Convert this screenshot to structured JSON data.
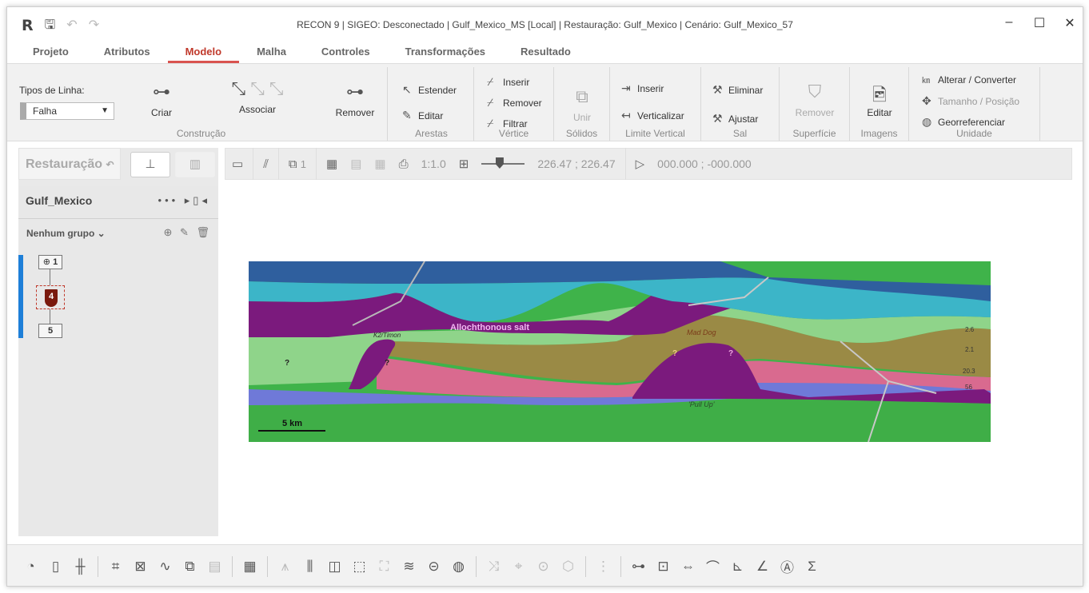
{
  "app": {
    "logo": "R",
    "title": "RECON 9  |  SIGEO: Desconectado  |  Gulf_Mexico_MS [Local]  |  Restauração: Gulf_Mexico  |  Cenário: Gulf_Mexico_57",
    "window_controls": {
      "minimize": "–",
      "maximize": "☐",
      "close": "✕"
    }
  },
  "menu": {
    "tabs": [
      {
        "label": "Projeto"
      },
      {
        "label": "Atributos"
      },
      {
        "label": "Modelo",
        "active": true
      },
      {
        "label": "Malha"
      },
      {
        "label": "Controles"
      },
      {
        "label": "Transformações"
      },
      {
        "label": "Resultado"
      }
    ]
  },
  "ribbon": {
    "construcao": {
      "tipos_label": "Tipos de Linha:",
      "tipo_value": "Falha",
      "criar": "Criar",
      "associar": "Associar",
      "remover": "Remover",
      "group": "Construção"
    },
    "arestas": {
      "estender": "Estender",
      "editar": "Editar",
      "group": "Arestas"
    },
    "vertice": {
      "inserir": "Inserir",
      "remover": "Remover",
      "filtrar": "Filtrar",
      "group": "Vértice"
    },
    "solidos": {
      "unir": "Unir",
      "group": "Sólidos"
    },
    "limite": {
      "inserir": "Inserir",
      "verticalizar": "Verticalizar",
      "group": "Limite Vertical"
    },
    "sal": {
      "eliminar": "Eliminar",
      "ajustar": "Ajustar",
      "group": "Sal"
    },
    "superficie": {
      "remover": "Remover",
      "group": "Superfície"
    },
    "imagens": {
      "editar": "Editar",
      "group": "Imagens"
    },
    "unidade": {
      "alterar": "Alterar / Converter",
      "tamanho": "Tamanho / Posição",
      "geo": "Georreferenciar",
      "group": "Unidade"
    }
  },
  "left_panel": {
    "restauracao": "Restauração",
    "project_name": "Gulf_Mexico",
    "project_icons": "••• ▸▯◂",
    "group_selector": "Nenhum grupo",
    "group_tools": "⊕ ✎ 🗑",
    "nodes": [
      "1",
      "4",
      "5"
    ]
  },
  "canvas_toolbar": {
    "layer_count": "1",
    "scale": "1:1.0",
    "zoom_value": 40,
    "coords": "226.47 ; 226.47",
    "cursor_pos": "000.000 ; -000.000"
  },
  "section_labels": {
    "allochthonous": "Allochthonous salt",
    "k2": "K2/Timon",
    "mad_dog": "Mad Dog",
    "pull_up": "'Pull Up'",
    "scale": "5 km",
    "q": "?",
    "r1": "2.6",
    "r2": "2.1",
    "r3": "20.3",
    "r4": "56"
  },
  "colors": {
    "accent": "#d9534f",
    "water": "#2f5f9e",
    "cyan": "#3cb5c8",
    "salt": "#7b1a7d",
    "green_light": "#8fd48a",
    "olive": "#9a8a45",
    "pink": "#d96a8f",
    "blue_band": "#6f79d8",
    "green_deep": "#3fb34a"
  }
}
